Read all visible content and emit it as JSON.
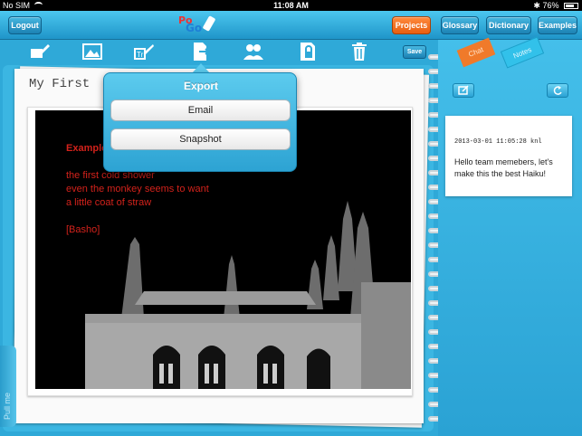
{
  "status_bar": {
    "carrier": "No SIM",
    "time": "11:08 AM",
    "battery": "76%",
    "battery_level": 0.76
  },
  "top_nav": {
    "logout_label": "Logout",
    "logo_text_top": "Po",
    "logo_text_bottom": "Go",
    "projects_label": "Projects",
    "glossary_label": "Glossary",
    "dictionary_label": "Dictionary",
    "examples_label": "Examples"
  },
  "toolbar": {
    "icons": [
      "edit-text-icon",
      "image-icon",
      "text-style-icon",
      "export-icon",
      "team-icon",
      "lock-icon",
      "trash-icon"
    ],
    "save_label": "Save"
  },
  "document": {
    "title": "My First",
    "poem_heading": "Example",
    "poem_lines": [
      "the first cold shower",
      "even the monkey seems to want",
      "a little coat of straw"
    ],
    "poem_author": "[Basho]",
    "pull_me": "Pull me"
  },
  "export_popover": {
    "title": "Export",
    "options": [
      "Email",
      "Snapshot"
    ]
  },
  "side_panel": {
    "tabs": [
      "Chat",
      "Notes"
    ],
    "note": {
      "timestamp": "2013-03-01 11:05:28 knl",
      "message": "Hello team memebers, let's make this the best Haiku!"
    }
  },
  "colors": {
    "accent": "#2fa9d8",
    "active_button": "#f07a2a",
    "poem_text": "#d3221b"
  }
}
